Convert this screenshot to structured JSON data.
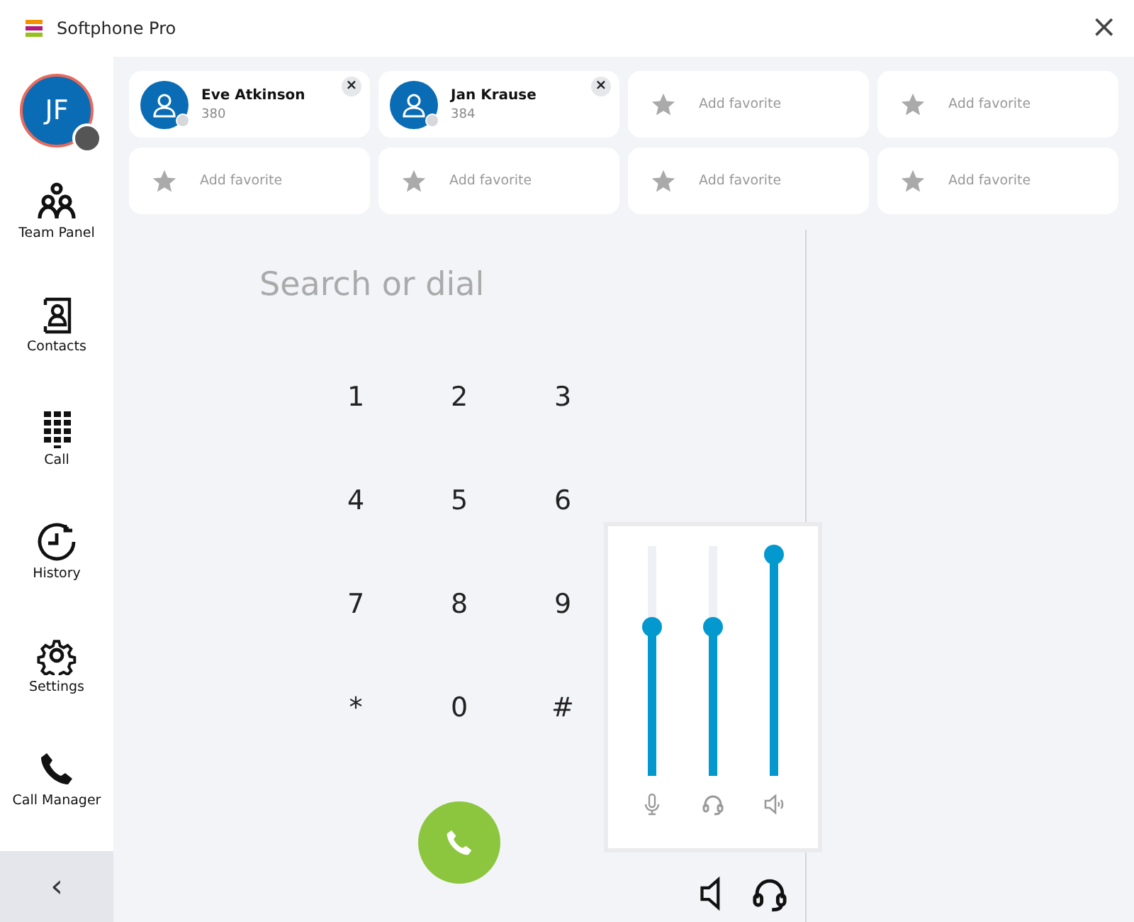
{
  "window": {
    "title": "Softphone Pro",
    "close": "×"
  },
  "user": {
    "initials": "JF"
  },
  "sidebar": {
    "items": [
      {
        "kind": "team",
        "label": "Team Panel"
      },
      {
        "kind": "contacts",
        "label": "Contacts"
      },
      {
        "kind": "dialpad",
        "label": "Call"
      },
      {
        "kind": "history",
        "label": "History"
      },
      {
        "kind": "settings",
        "label": "Settings"
      },
      {
        "kind": "phone",
        "label": "Call Manager"
      }
    ],
    "collapse": "‹"
  },
  "favorites": [
    {
      "kind": "contact",
      "name": "Eve Atkinson",
      "extension": "380",
      "remove": "×"
    },
    {
      "kind": "contact",
      "name": "Jan Krause",
      "extension": "384",
      "remove": "×"
    },
    {
      "kind": "empty",
      "label": "Add favorite"
    },
    {
      "kind": "empty",
      "label": "Add favorite"
    },
    {
      "kind": "empty",
      "label": "Add favorite"
    },
    {
      "kind": "empty",
      "label": "Add favorite"
    },
    {
      "kind": "empty",
      "label": "Add favorite"
    },
    {
      "kind": "empty",
      "label": "Add favorite"
    }
  ],
  "dialer": {
    "placeholder": "Search or dial",
    "keys": [
      "1",
      "2",
      "3",
      "4",
      "5",
      "6",
      "7",
      "8",
      "9",
      "*",
      "0",
      "#"
    ]
  },
  "volume": {
    "sliders": [
      {
        "kind": "microphone",
        "level": 0.65
      },
      {
        "kind": "headset",
        "level": 0.65
      },
      {
        "kind": "speaker",
        "level": 0.96
      }
    ]
  }
}
